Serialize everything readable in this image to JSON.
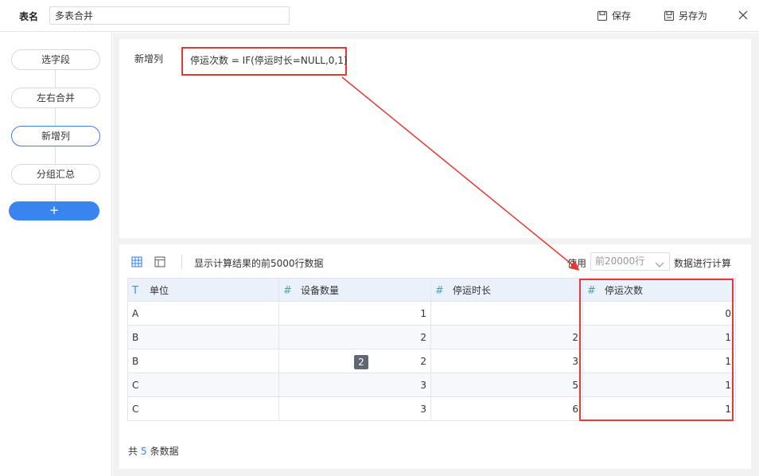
{
  "header": {
    "table_name_label": "表名",
    "table_name_value": "多表合并",
    "save_label": "保存",
    "save_as_label": "另存为"
  },
  "steps": [
    {
      "label": "选字段",
      "active": false
    },
    {
      "label": "左右合并",
      "active": false
    },
    {
      "label": "新增列",
      "active": true
    },
    {
      "label": "分组汇总",
      "active": false
    }
  ],
  "add_step_label": "+",
  "formula": {
    "label": "新增列",
    "expression": "停运次数 = IF(停运时长=NULL,0,1)"
  },
  "preview": {
    "info": "显示计算结果的前5000行数据",
    "use_label": "使用",
    "rows_select_placeholder": "前20000行",
    "after_label": "数据进行计算",
    "columns": [
      {
        "name": "单位",
        "type_icon": "T"
      },
      {
        "name": "设备数量",
        "type_icon": "#"
      },
      {
        "name": "停运时长",
        "type_icon": "#"
      },
      {
        "name": "停运次数",
        "type_icon": "#"
      }
    ],
    "rows": [
      [
        "A",
        "1",
        "",
        "0"
      ],
      [
        "B",
        "2",
        "2",
        "1"
      ],
      [
        "B",
        "2",
        "3",
        "1"
      ],
      [
        "C",
        "3",
        "5",
        "1"
      ],
      [
        "C",
        "3",
        "6",
        "1"
      ]
    ],
    "badge": "2",
    "footer_prefix": "共",
    "footer_count": "5",
    "footer_suffix": "条数据"
  },
  "colors": {
    "accent": "#3a84f0",
    "annotation": "#e53935",
    "header_bg": "#eaf1fb"
  }
}
